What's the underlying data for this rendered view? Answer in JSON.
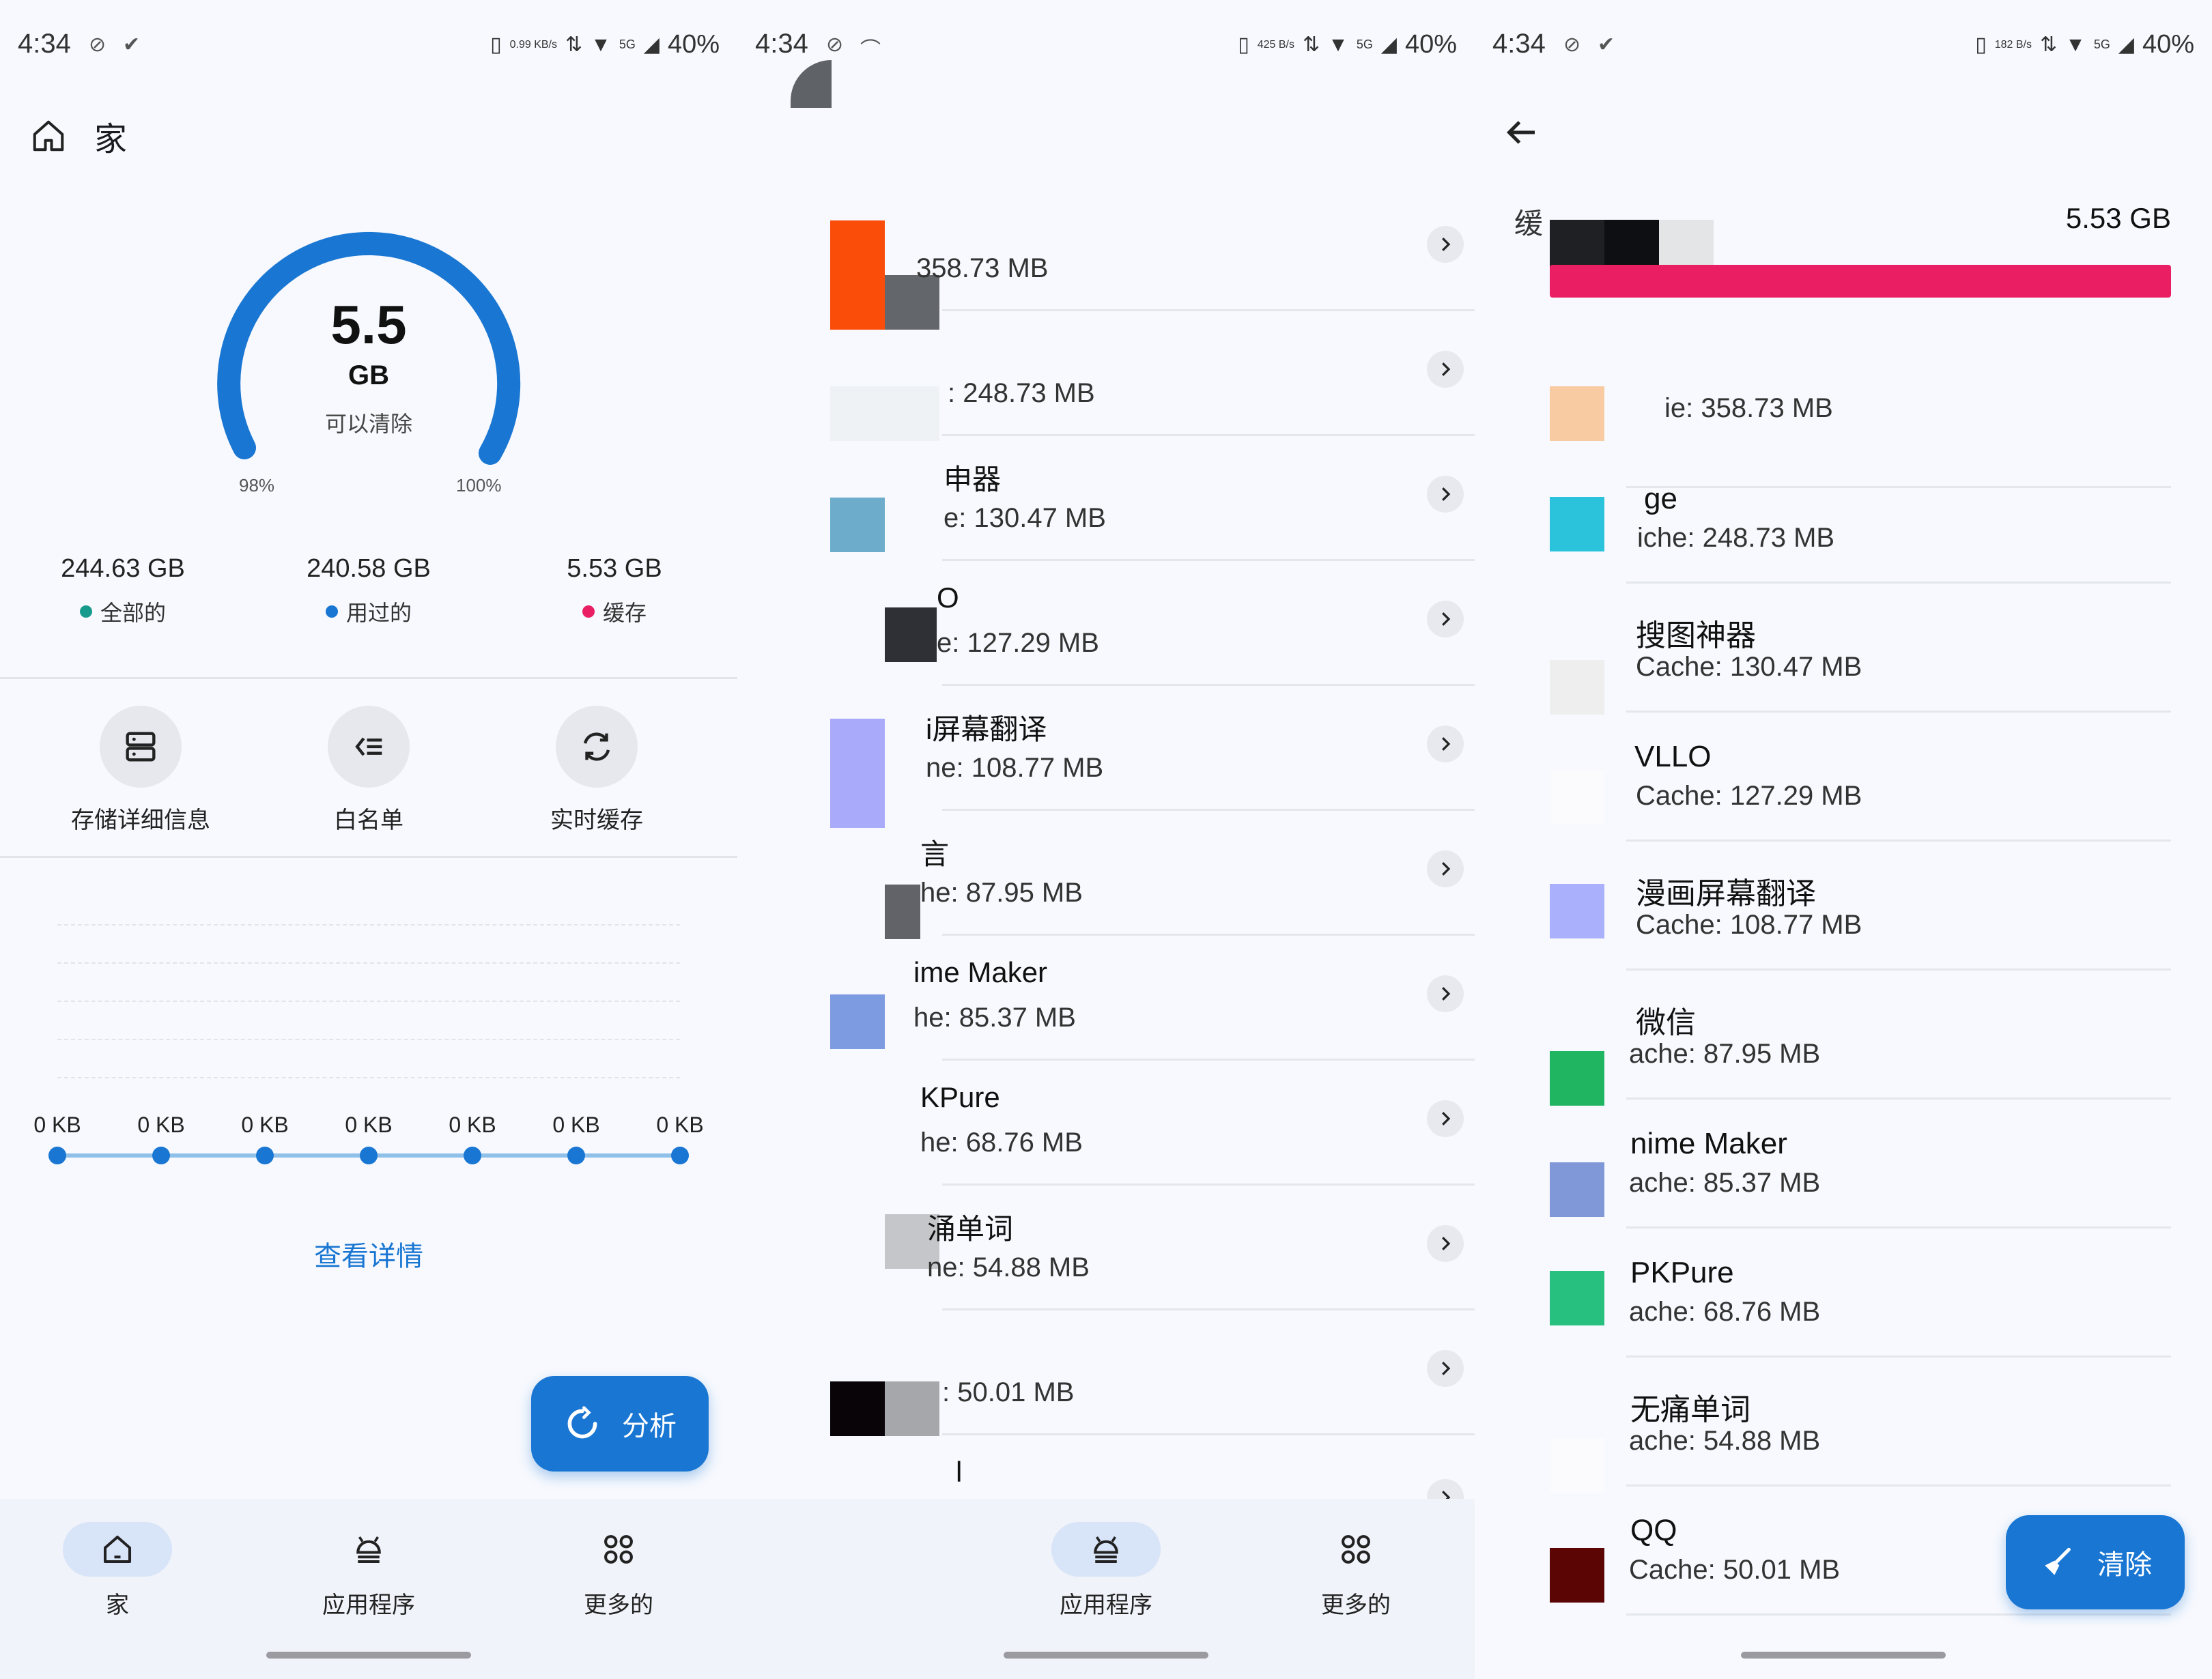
{
  "status": {
    "time": "4:34",
    "speed": [
      "0.99 KB/s",
      "425 B/s",
      "182 B/s"
    ],
    "network": "5G",
    "battery": "40%"
  },
  "home": {
    "title": "家",
    "gauge": {
      "value": "5.5",
      "unit": "GB",
      "caption": "可以清除",
      "min_label": "98%",
      "max_label": "100%"
    },
    "stats": [
      {
        "value": "244.63 GB",
        "label": "全部的",
        "color": "#159a8c"
      },
      {
        "value": "240.58 GB",
        "label": "用过的",
        "color": "#1976d2"
      },
      {
        "value": "5.53 GB",
        "label": "缓存",
        "color": "#e91e63"
      }
    ],
    "actions": [
      {
        "label": "存储详细信息",
        "icon": "storage-icon"
      },
      {
        "label": "白名单",
        "icon": "whitelist-icon"
      },
      {
        "label": "实时缓存",
        "icon": "sync-icon"
      }
    ],
    "timeline": [
      "0 KB",
      "0 KB",
      "0 KB",
      "0 KB",
      "0 KB",
      "0 KB",
      "0 KB"
    ],
    "view_details": "查看详情",
    "analyze": "分析"
  },
  "nav": {
    "home": "家",
    "apps": "应用程序",
    "more": "更多的"
  },
  "apps": {
    "items": [
      {
        "name": "",
        "size": "358.73 MB",
        "size_text": "358.73 MB"
      },
      {
        "name": "",
        "size": "248.73 MB",
        "size_text": ": 248.73 MB"
      },
      {
        "name": "申器",
        "size": "130.47 MB",
        "size_text": "e: 130.47 MB"
      },
      {
        "name": "O",
        "size": "127.29 MB",
        "size_text": "e: 127.29 MB"
      },
      {
        "name": "i屏幕翻译",
        "size": "108.77 MB",
        "size_text": "ne: 108.77 MB"
      },
      {
        "name": "言",
        "size": "87.95 MB",
        "size_text": "he: 87.95 MB"
      },
      {
        "name": "ime Maker",
        "size": "85.37 MB",
        "size_text": "he: 85.37 MB"
      },
      {
        "name": "KPure",
        "size": "68.76 MB",
        "size_text": "he: 68.76 MB"
      },
      {
        "name": "涌单词",
        "size": "54.88 MB",
        "size_text": "ne: 54.88 MB"
      },
      {
        "name": "",
        "size": "50.01 MB",
        "size_text": ": 50.01 MB"
      },
      {
        "name": "l",
        "size": "",
        "size_text": ""
      }
    ]
  },
  "cache": {
    "header_label": "缓",
    "total": "5.53 GB",
    "bar_color": "#e91e63",
    "items": [
      {
        "name": "",
        "size_text": "ie: 358.73 MB",
        "color": "#f8cba3"
      },
      {
        "name": "ge",
        "size_text": "iche: 248.73 MB",
        "color": "#2bc3db"
      },
      {
        "name": "搜图神器",
        "size_text": "Cache: 130.47 MB",
        "color": "#eeeeee"
      },
      {
        "name": "VLLO",
        "size_text": "Cache: 127.29 MB",
        "color": "#fbfbfd"
      },
      {
        "name": "漫画屏幕翻译",
        "size_text": "Cache: 108.77 MB",
        "color": "#aab0fb"
      },
      {
        "name": "微信",
        "size_text": "ache: 87.95 MB",
        "color": "#20b560"
      },
      {
        "name": "nime Maker",
        "size_text": "ache: 85.37 MB",
        "color": "#8097d8"
      },
      {
        "name": "PKPure",
        "size_text": "ache: 68.76 MB",
        "color": "#27c07f"
      },
      {
        "name": "无痛单词",
        "size_text": "ache: 54.88 MB",
        "color": "#fbfbfd"
      },
      {
        "name": "QQ",
        "size_text": "Cache: 50.01 MB",
        "color": "#5c0505"
      }
    ],
    "clear": "清除"
  }
}
